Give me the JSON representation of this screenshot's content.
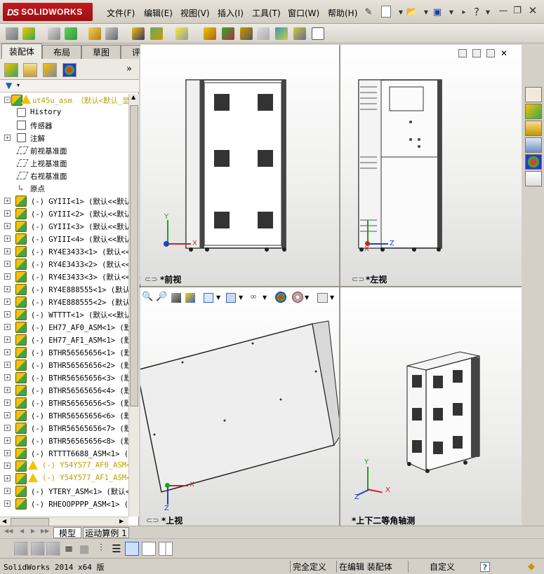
{
  "app": {
    "brand": "SOLIDWORKS",
    "brand_prefix": "DS"
  },
  "menu": [
    "文件(F)",
    "编辑(E)",
    "视图(V)",
    "插入(I)",
    "工具(T)",
    "窗口(W)",
    "帮助(H)"
  ],
  "tabs": [
    "装配体",
    "布局",
    "草图",
    "评估"
  ],
  "feature_tree": {
    "root": "ut45u_asm （默认<默认_显",
    "items": [
      {
        "kind": "history",
        "label": "History"
      },
      {
        "kind": "sensor",
        "label": "传感器"
      },
      {
        "kind": "annotation",
        "label": "注解"
      },
      {
        "kind": "plane",
        "label": "前视基准面"
      },
      {
        "kind": "plane",
        "label": "上视基准面"
      },
      {
        "kind": "plane",
        "label": "右视基准面"
      },
      {
        "kind": "origin",
        "label": "原点"
      },
      {
        "kind": "part",
        "label": "(-) GYIII<1> (默认<<默认"
      },
      {
        "kind": "part",
        "label": "(-) GYIII<2> (默认<<默认"
      },
      {
        "kind": "part",
        "label": "(-) GYIII<3> (默认<<默认"
      },
      {
        "kind": "part",
        "label": "(-) GYIII<4> (默认<<默认"
      },
      {
        "kind": "part",
        "label": "(-) RY4E3433<1> (默认<<"
      },
      {
        "kind": "part",
        "label": "(-) RY4E3433<2> (默认<<"
      },
      {
        "kind": "part",
        "label": "(-) RY4E3433<3> (默认<<"
      },
      {
        "kind": "part",
        "label": "(-) RY4E888555<1> (默认"
      },
      {
        "kind": "part",
        "label": "(-) RY4E888555<2> (默认"
      },
      {
        "kind": "part",
        "label": "(-) WTTTT<1> (默认<<默认"
      },
      {
        "kind": "asm",
        "label": "(-) EH77_AF0_ASM<1> (默"
      },
      {
        "kind": "asm",
        "label": "(-) EH77_AF1_ASM<1> (默"
      },
      {
        "kind": "part",
        "label": "(-) BTHR56565656<1> (默"
      },
      {
        "kind": "part",
        "label": "(-) BTHR56565656<2> (默"
      },
      {
        "kind": "part",
        "label": "(-) BTHR56565656<3> (默"
      },
      {
        "kind": "part",
        "label": "(-) BTHR56565656<4> (默"
      },
      {
        "kind": "part",
        "label": "(-) BTHR56565656<5> (默"
      },
      {
        "kind": "part",
        "label": "(-) BTHR56565656<6> (默"
      },
      {
        "kind": "part",
        "label": "(-) BTHR56565656<7> (默"
      },
      {
        "kind": "part",
        "label": "(-) BTHR56565656<8> (默"
      },
      {
        "kind": "part",
        "label": "(-) RTTTT6688_ASM<1> (默"
      },
      {
        "kind": "warn",
        "label": "(-) Y54Y577_AF0_ASM<"
      },
      {
        "kind": "warn",
        "label": "(-) Y54Y577_AF1_ASM<"
      },
      {
        "kind": "part",
        "label": "(-) YTERY_ASM<1> (默认<"
      },
      {
        "kind": "part",
        "label": "(-) RHEOOPPPP_ASM<1> (默"
      }
    ]
  },
  "viewports": {
    "front": "*前视",
    "left": "*左视",
    "top": "*上视",
    "iso": "*上下二等角轴测"
  },
  "axes": {
    "x": "X",
    "y": "Y",
    "z": "Z"
  },
  "model_tabs": [
    "模型",
    "运动算例 1"
  ],
  "status": {
    "app": "SolidWorks 2014 x64 版",
    "definition": "完全定义",
    "mode": "在编辑 装配体",
    "units": "自定义",
    "help": "?"
  },
  "colors": {
    "accent_red": "#c41a1f",
    "axis_x": "#d02020",
    "axis_y": "#20a020",
    "axis_z": "#2040c0"
  }
}
